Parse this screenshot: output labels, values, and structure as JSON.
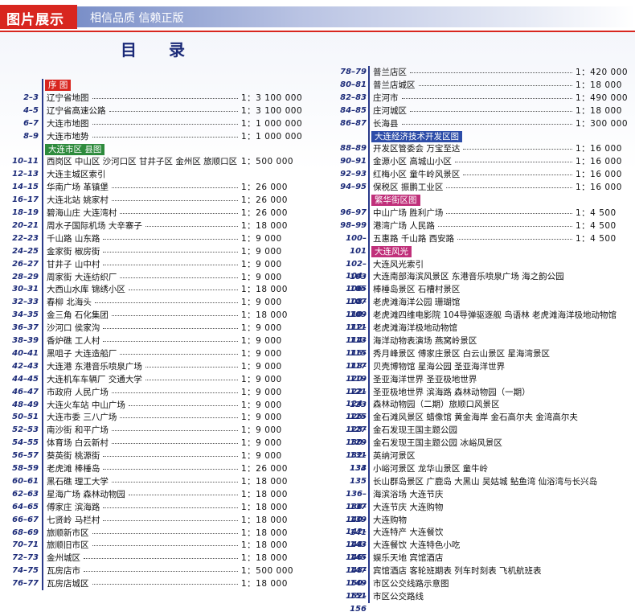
{
  "header": {
    "tag_label": "图片展示",
    "slogan": "相信品质 信赖正版"
  },
  "toc": {
    "title": "目录",
    "left": [
      {
        "type": "section",
        "label": "序 图",
        "color": "red"
      },
      {
        "type": "row",
        "page": "2–3",
        "name": "辽宁省地图",
        "scale": "1：3 100 000"
      },
      {
        "type": "row",
        "page": "4–5",
        "name": "辽宁省高速公路",
        "scale": "1：3 100 000"
      },
      {
        "type": "row",
        "page": "6–7",
        "name": "大连市地图",
        "scale": "1：1 000 000"
      },
      {
        "type": "row",
        "page": "8–9",
        "name": "大连市地势",
        "scale": "1：1 000 000"
      },
      {
        "type": "section",
        "label": "大连市区 县图",
        "color": "green"
      },
      {
        "type": "row",
        "page": "10–11",
        "name": "西岗区 中山区 沙河口区 甘井子区 金州区 旅顺口区",
        "scale": "1：500 000"
      },
      {
        "type": "row",
        "page": "12–13",
        "name": "大连主城区索引",
        "scale": ""
      },
      {
        "type": "row",
        "page": "14–15",
        "name": "华南广场 革镇堡",
        "scale": "1：26 000"
      },
      {
        "type": "row",
        "page": "16–17",
        "name": "大连北站 姚家村",
        "scale": "1：26 000"
      },
      {
        "type": "row",
        "page": "18–19",
        "name": "碧海山庄 大连湾村",
        "scale": "1：26 000"
      },
      {
        "type": "row",
        "page": "20–21",
        "name": "周水子国际机场 大辛寨子",
        "scale": "1：18 000"
      },
      {
        "type": "row",
        "page": "22–23",
        "name": "千山路 山东路",
        "scale": "1：9 000"
      },
      {
        "type": "row",
        "page": "24–25",
        "name": "金家街 椒房街",
        "scale": "1：9 000"
      },
      {
        "type": "row",
        "page": "26–27",
        "name": "甘井子 山中村",
        "scale": "1：9 000"
      },
      {
        "type": "row",
        "page": "28–29",
        "name": "周家街 大连纺织厂",
        "scale": "1：9 000"
      },
      {
        "type": "row",
        "page": "30–31",
        "name": "大西山水库 锦绣小区",
        "scale": "1：18 000"
      },
      {
        "type": "row",
        "page": "32–33",
        "name": "春柳 北海头",
        "scale": "1：9 000"
      },
      {
        "type": "row",
        "page": "34–35",
        "name": "金三角 石化集团",
        "scale": "1：18 000"
      },
      {
        "type": "row",
        "page": "36–37",
        "name": "沙河口 侯家沟",
        "scale": "1：9 000"
      },
      {
        "type": "row",
        "page": "38–39",
        "name": "香炉礁 工人村",
        "scale": "1：9 000"
      },
      {
        "type": "row",
        "page": "40–41",
        "name": "黑咀子 大连造船厂",
        "scale": "1：9 000"
      },
      {
        "type": "row",
        "page": "42–43",
        "name": "大连港 东港音乐喷泉广场",
        "scale": "1：9 000"
      },
      {
        "type": "row",
        "page": "44–45",
        "name": "大连机车车辆厂 交通大学",
        "scale": "1：9 000"
      },
      {
        "type": "row",
        "page": "46–47",
        "name": "市政府 人民广场",
        "scale": "1：9 000"
      },
      {
        "type": "row",
        "page": "48–49",
        "name": "大连火车站 中山广场",
        "scale": "1：9 000"
      },
      {
        "type": "row",
        "page": "50–51",
        "name": "大连市委 三八广场",
        "scale": "1：9 000"
      },
      {
        "type": "row",
        "page": "52–53",
        "name": "南沙街 和平广场",
        "scale": "1：9 000"
      },
      {
        "type": "row",
        "page": "54–55",
        "name": "体育场 白云新村",
        "scale": "1：9 000"
      },
      {
        "type": "row",
        "page": "56–57",
        "name": "葵英街 桃源街",
        "scale": "1：9 000"
      },
      {
        "type": "row",
        "page": "58–59",
        "name": "老虎滩 棒棰岛",
        "scale": "1：26 000"
      },
      {
        "type": "row",
        "page": "60–61",
        "name": "黑石礁 理工大学",
        "scale": "1：18 000"
      },
      {
        "type": "row",
        "page": "62–63",
        "name": "星海广场 森林动物园",
        "scale": "1：18 000"
      },
      {
        "type": "row",
        "page": "64–65",
        "name": "傅家庄 滨海路",
        "scale": "1：18 000"
      },
      {
        "type": "row",
        "page": "66–67",
        "name": "七贤岭 马栏村",
        "scale": "1：18 000"
      },
      {
        "type": "row",
        "page": "68–69",
        "name": "旅顺新市区",
        "scale": "1：18 000"
      },
      {
        "type": "row",
        "page": "70–71",
        "name": "旅顺旧市区",
        "scale": "1：18 000"
      },
      {
        "type": "row",
        "page": "72–73",
        "name": "金州城区",
        "scale": "1：18 000"
      },
      {
        "type": "row",
        "page": "74–75",
        "name": "瓦房店市",
        "scale": "1：500 000"
      },
      {
        "type": "row",
        "page": "76–77",
        "name": "瓦房店城区",
        "scale": "1：18 000"
      }
    ],
    "right": [
      {
        "type": "row",
        "page": "78–79",
        "name": "普兰店区",
        "scale": "1：420 000"
      },
      {
        "type": "row",
        "page": "80–81",
        "name": "普兰店城区",
        "scale": "1：18 000"
      },
      {
        "type": "row",
        "page": "82–83",
        "name": "庄河市",
        "scale": "1：490 000"
      },
      {
        "type": "row",
        "page": "84–85",
        "name": "庄河城区",
        "scale": "1：18 000"
      },
      {
        "type": "row",
        "page": "86–87",
        "name": "长海县",
        "scale": "1：300 000"
      },
      {
        "type": "section",
        "label": "大连经济技术开发区图",
        "color": "blue"
      },
      {
        "type": "row",
        "page": "88–89",
        "name": "开发区管委会 万宝至达",
        "scale": "1：16 000"
      },
      {
        "type": "row",
        "page": "90–91",
        "name": "金源小区 高城山小区",
        "scale": "1：16 000"
      },
      {
        "type": "row",
        "page": "92–93",
        "name": "红梅小区 童牛岭风景区",
        "scale": "1：16 000"
      },
      {
        "type": "row",
        "page": "94–95",
        "name": "保税区 振鹏工业区",
        "scale": "1：16 000"
      },
      {
        "type": "section",
        "label": "繁华街区图",
        "color": "magenta"
      },
      {
        "type": "row",
        "page": "96–97",
        "name": "中山广场 胜利广场",
        "scale": "1：4 500"
      },
      {
        "type": "row",
        "page": "98–99",
        "name": "港湾广场 人民路",
        "scale": "1：4 500"
      },
      {
        "type": "row",
        "page": "100–101",
        "name": "五惠路 千山路 西安路",
        "scale": "1：4 500"
      },
      {
        "type": "section",
        "label": "大连风光",
        "color": "magenta"
      },
      {
        "type": "row",
        "page": "102–103",
        "name": "大连风光索引",
        "scale": ""
      },
      {
        "type": "row",
        "page": "104–105",
        "name": "大连南部海滨风景区 东港音乐喷泉广场 海之韵公园",
        "scale": ""
      },
      {
        "type": "row",
        "page": "106–107",
        "name": "棒棰岛景区 石槽村景区",
        "scale": ""
      },
      {
        "type": "row",
        "page": "108–109",
        "name": "老虎滩海洋公园 珊瑚馆",
        "scale": ""
      },
      {
        "type": "row",
        "page": "110–111",
        "name": "老虎滩四维电影院 104导弹驱逐舰 鸟语林 老虎滩海洋极地动物馆",
        "scale": ""
      },
      {
        "type": "row",
        "page": "112–113",
        "name": "老虎滩海洋极地动物馆",
        "scale": ""
      },
      {
        "type": "row",
        "page": "114–115",
        "name": "海洋动物表演场 燕窝岭景区",
        "scale": ""
      },
      {
        "type": "row",
        "page": "116–117",
        "name": "秀月峰景区 傅家庄景区 白云山景区 星海湾景区",
        "scale": ""
      },
      {
        "type": "row",
        "page": "118–119",
        "name": "贝壳博物馆 星海公园 圣亚海洋世界",
        "scale": ""
      },
      {
        "type": "row",
        "page": "120–121",
        "name": "圣亚海洋世界 圣亚极地世界",
        "scale": ""
      },
      {
        "type": "row",
        "page": "122–123",
        "name": "圣亚极地世界 滨海路 森林动物园（一期）",
        "scale": ""
      },
      {
        "type": "row",
        "page": "124–125",
        "name": "森林动物园（二期）旅顺口风景区",
        "scale": ""
      },
      {
        "type": "row",
        "page": "126–127",
        "name": "金石滩风景区 蜡像馆 黄金海岸 金石高尔夫 金湾高尔夫",
        "scale": ""
      },
      {
        "type": "row",
        "page": "128–129",
        "name": "金石发现王国主题公园",
        "scale": ""
      },
      {
        "type": "row",
        "page": "130–131",
        "name": "金石发现王国主题公园 冰峪风景区",
        "scale": ""
      },
      {
        "type": "row",
        "page": "132–133",
        "name": "英纳河景区",
        "scale": ""
      },
      {
        "type": "row",
        "page": "134",
        "name": "小峪河景区 龙华山景区 童牛岭",
        "scale": ""
      },
      {
        "type": "row",
        "page": "135",
        "name": "长山群岛景区 广鹿岛 大黑山 吴姑城 鲇鱼湾 仙浴湾与长兴岛",
        "scale": ""
      },
      {
        "type": "row",
        "page": "136–137",
        "name": "海滨浴场 大连节庆",
        "scale": ""
      },
      {
        "type": "row",
        "page": "138–139",
        "name": "大连节庆 大连购物",
        "scale": ""
      },
      {
        "type": "row",
        "page": "140–141",
        "name": "大连购物",
        "scale": ""
      },
      {
        "type": "row",
        "page": "142–143",
        "name": "大连特产 大连餐饮",
        "scale": ""
      },
      {
        "type": "row",
        "page": "144–145",
        "name": "大连餐饮 大连特色小吃",
        "scale": ""
      },
      {
        "type": "row",
        "page": "146–147",
        "name": "娱乐天地 宾馆酒店",
        "scale": ""
      },
      {
        "type": "row",
        "page": "148–149",
        "name": "宾馆酒店 客轮班期表 列车时刻表 飞机航班表",
        "scale": ""
      },
      {
        "type": "row",
        "page": "150–151",
        "name": "市区公交线路示意图",
        "scale": ""
      },
      {
        "type": "row",
        "page": "152–156",
        "name": "市区公交路线",
        "scale": ""
      }
    ]
  }
}
